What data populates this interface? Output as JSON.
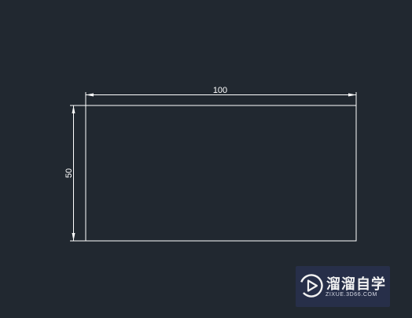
{
  "drawing": {
    "rectangle": {
      "width": 100,
      "height": 50
    },
    "dimensions": {
      "horizontal_label": "100",
      "vertical_label": "50"
    },
    "colors": {
      "background": "#212830",
      "linework": "#ffffff"
    }
  },
  "watermark": {
    "title": "溜溜自学",
    "url": "ZIXUE.3D66.COM",
    "logo_icon": "play-circle-icon",
    "colors": {
      "panel": "#28304e",
      "text": "#f2f2f2"
    }
  }
}
